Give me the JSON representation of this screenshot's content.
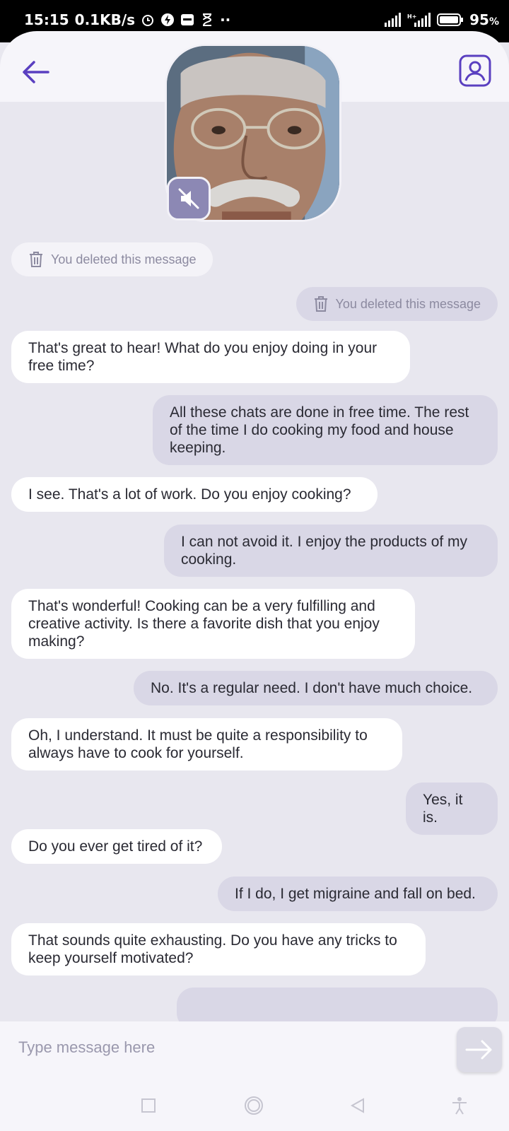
{
  "status_bar": {
    "time": "15:15",
    "speed": "0.1KB/s",
    "battery": "95",
    "battery_unit": "%"
  },
  "header": {
    "back_icon": "arrow-left-icon",
    "profile_icon": "user-profile-icon",
    "mute_icon": "speaker-muted-icon"
  },
  "messages": [
    {
      "dir": "in",
      "deleted": true,
      "text": "You deleted this message"
    },
    {
      "dir": "out",
      "deleted": true,
      "text": "You deleted this message"
    },
    {
      "dir": "in",
      "text": "That's great to hear! What do you enjoy doing in your free time?"
    },
    {
      "dir": "out",
      "text": "All these chats are done in free time. The rest of the time I do cooking my food and house keeping."
    },
    {
      "dir": "in",
      "text": "I see. That's a lot of work. Do you enjoy cooking?"
    },
    {
      "dir": "out",
      "text": "I can not avoid it. I enjoy the products of my cooking."
    },
    {
      "dir": "in",
      "text": "That's wonderful! Cooking can be a very fulfilling and creative activity. Is there a favorite dish that you enjoy making?"
    },
    {
      "dir": "out",
      "text": "No. It's a regular need. I don't have much choice."
    },
    {
      "dir": "in",
      "text": "Oh, I understand. It must be quite a responsibility to always have to cook for yourself."
    },
    {
      "dir": "out",
      "text": "Yes, it is."
    },
    {
      "dir": "in",
      "text": "Do you ever get tired of it?"
    },
    {
      "dir": "out",
      "text": "If I do, I get migraine and fall on bed."
    },
    {
      "dir": "in",
      "text": "That sounds quite exhausting. Do you have any tricks to keep yourself motivated?"
    }
  ],
  "composer": {
    "placeholder": "Type message here",
    "send_icon": "arrow-right-icon"
  },
  "nav": {
    "recents_icon": "square-icon",
    "home_icon": "circle-icon",
    "back_icon": "triangle-back-icon",
    "accessibility_icon": "accessibility-icon"
  }
}
